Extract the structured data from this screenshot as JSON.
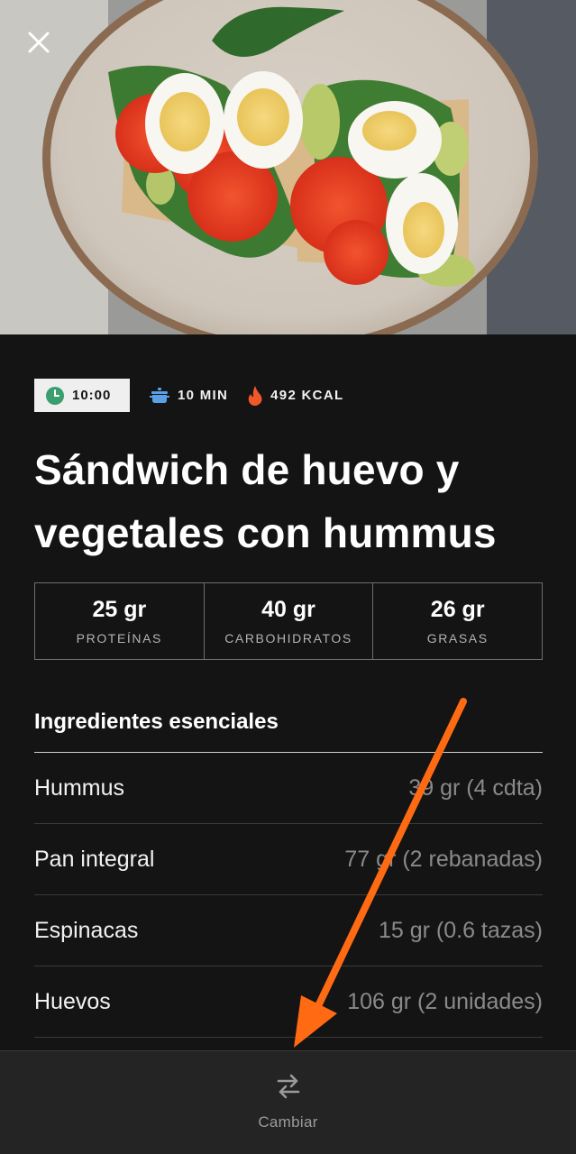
{
  "colors": {
    "background": "#141414",
    "chip_bg": "#efefef",
    "clock_green": "#3a9e6e",
    "pot_blue": "#5aa0e6",
    "flame_orange": "#f0582a",
    "bottom_bar": "#242424",
    "annotation_arrow": "#ff6a13"
  },
  "hero": {
    "image": "sandwich-photo",
    "close_icon": "close-icon"
  },
  "meta": {
    "time": "10:00",
    "time_icon": "clock-icon",
    "duration": "10 MIN",
    "duration_icon": "pot-icon",
    "calories": "492 KCAL",
    "calories_icon": "flame-icon"
  },
  "recipe": {
    "title": "Sándwich de huevo y vegetales con hummus"
  },
  "macros": [
    {
      "value": "25 gr",
      "label": "PROTEÍNAS"
    },
    {
      "value": "40 gr",
      "label": "CARBOHIDRATOS"
    },
    {
      "value": "26 gr",
      "label": "GRASAS"
    }
  ],
  "ingredients": {
    "title": "Ingredientes esenciales",
    "items": [
      {
        "name": "Hummus",
        "qty": "39 gr (4 cdta)"
      },
      {
        "name": "Pan integral",
        "qty": "77 gr (2 rebanadas)"
      },
      {
        "name": "Espinacas",
        "qty": "15 gr (0.6 tazas)"
      },
      {
        "name": "Huevos",
        "qty": "106 gr (2 unidades)"
      }
    ]
  },
  "bottom_bar": {
    "swap_icon": "swap-arrows-icon",
    "swap_label": "Cambiar"
  }
}
